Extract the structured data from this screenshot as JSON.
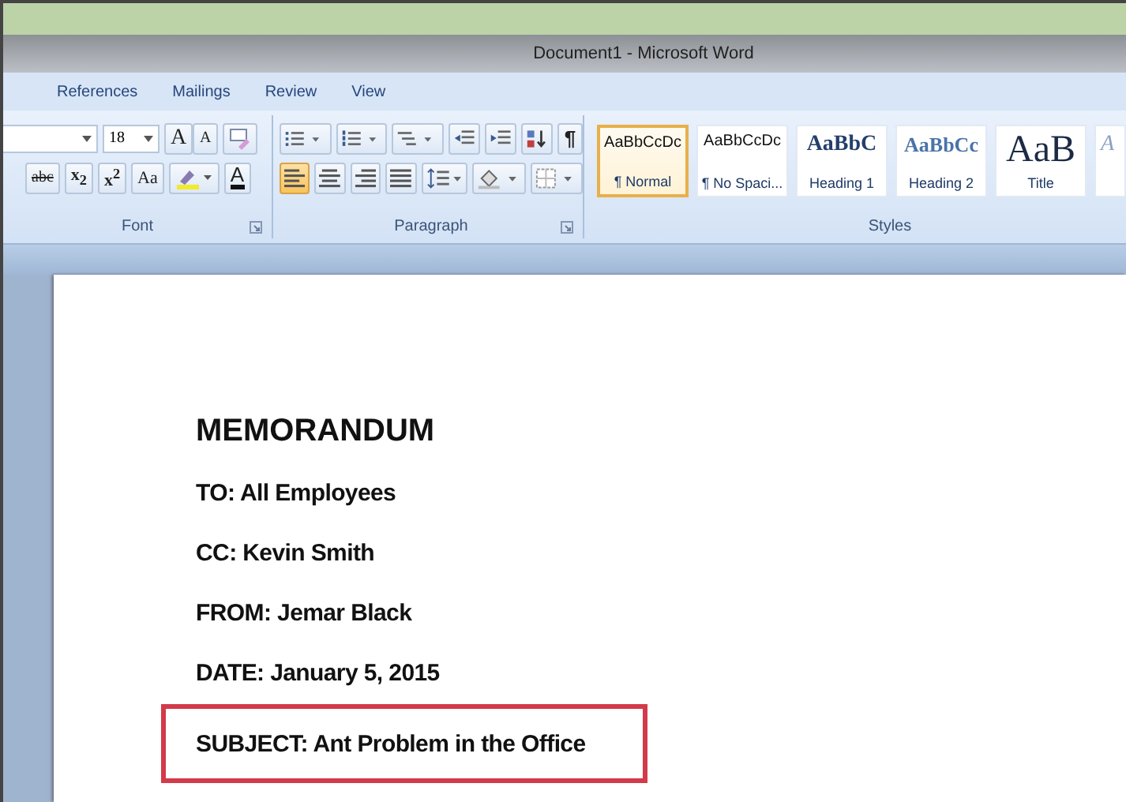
{
  "window": {
    "title": "Document1 - Microsoft Word"
  },
  "tabs": [
    {
      "label": "References",
      "selected": false
    },
    {
      "label": "Mailings",
      "selected": false
    },
    {
      "label": "Review",
      "selected": false
    },
    {
      "label": "View",
      "selected": false
    }
  ],
  "font_group": {
    "name": "Font",
    "size": "18",
    "grow": "A",
    "shrink": "A",
    "strikethrough": "abc",
    "subscript": "x$_{2}$",
    "superscript": "x$^{2}$",
    "change_case": "Aa",
    "font_color": "A"
  },
  "paragraph_group": {
    "name": "Paragraph",
    "show_marks": "¶",
    "alignments": [
      {
        "selected": true
      },
      {
        "selected": false
      },
      {
        "selected": false
      },
      {
        "selected": false
      }
    ]
  },
  "styles_group": {
    "name": "Styles",
    "styles": [
      {
        "kind": "normal",
        "sample": "AaBbCcDc",
        "label": "¶ Normal",
        "selected": true
      },
      {
        "kind": "normal",
        "sample": "AaBbCcDc",
        "label": "¶ No Spaci...",
        "selected": false
      },
      {
        "kind": "heading1",
        "sample": "AaBbC",
        "label": "Heading 1",
        "selected": false
      },
      {
        "kind": "heading2",
        "sample": "AaBbCc",
        "label": "Heading 2",
        "selected": false
      },
      {
        "kind": "title",
        "sample": "AaB",
        "label": "Title",
        "selected": false
      },
      {
        "kind": "cut",
        "sample": "A",
        "selected": false
      }
    ]
  },
  "document": {
    "heading": "MEMORANDUM",
    "lines": [
      {
        "text": "TO: All Employees",
        "highlighted": false
      },
      {
        "text": "CC: Kevin Smith",
        "highlighted": false
      },
      {
        "text": "FROM: Jemar Black",
        "highlighted": false
      },
      {
        "text": "DATE: January 5, 2015",
        "highlighted": false
      },
      {
        "text": "SUBJECT: Ant Problem in the Office",
        "highlighted": true
      }
    ]
  }
}
